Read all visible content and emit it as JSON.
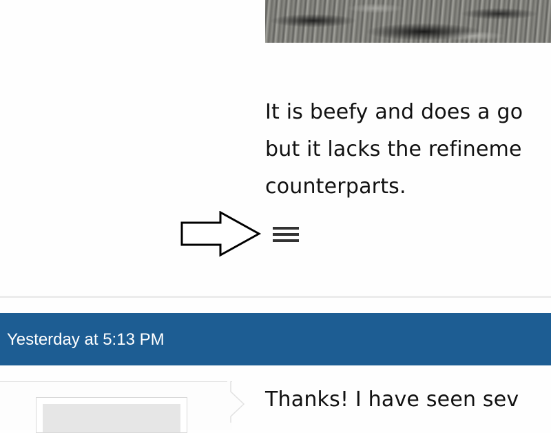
{
  "post": {
    "body_lines": [
      "It is beefy and does a go",
      "but it lacks the refineme",
      "counterparts."
    ]
  },
  "annotation": {
    "icon": "outline-arrow-right-icon"
  },
  "menu": {
    "icon": "hamburger-menu-icon"
  },
  "reply": {
    "timestamp": "Yesterday at 5:13 PM",
    "text": "Thanks! I have seen sev"
  },
  "colors": {
    "date_bar": "#1d5d93",
    "text": "#111111",
    "divider": "#ececec"
  }
}
